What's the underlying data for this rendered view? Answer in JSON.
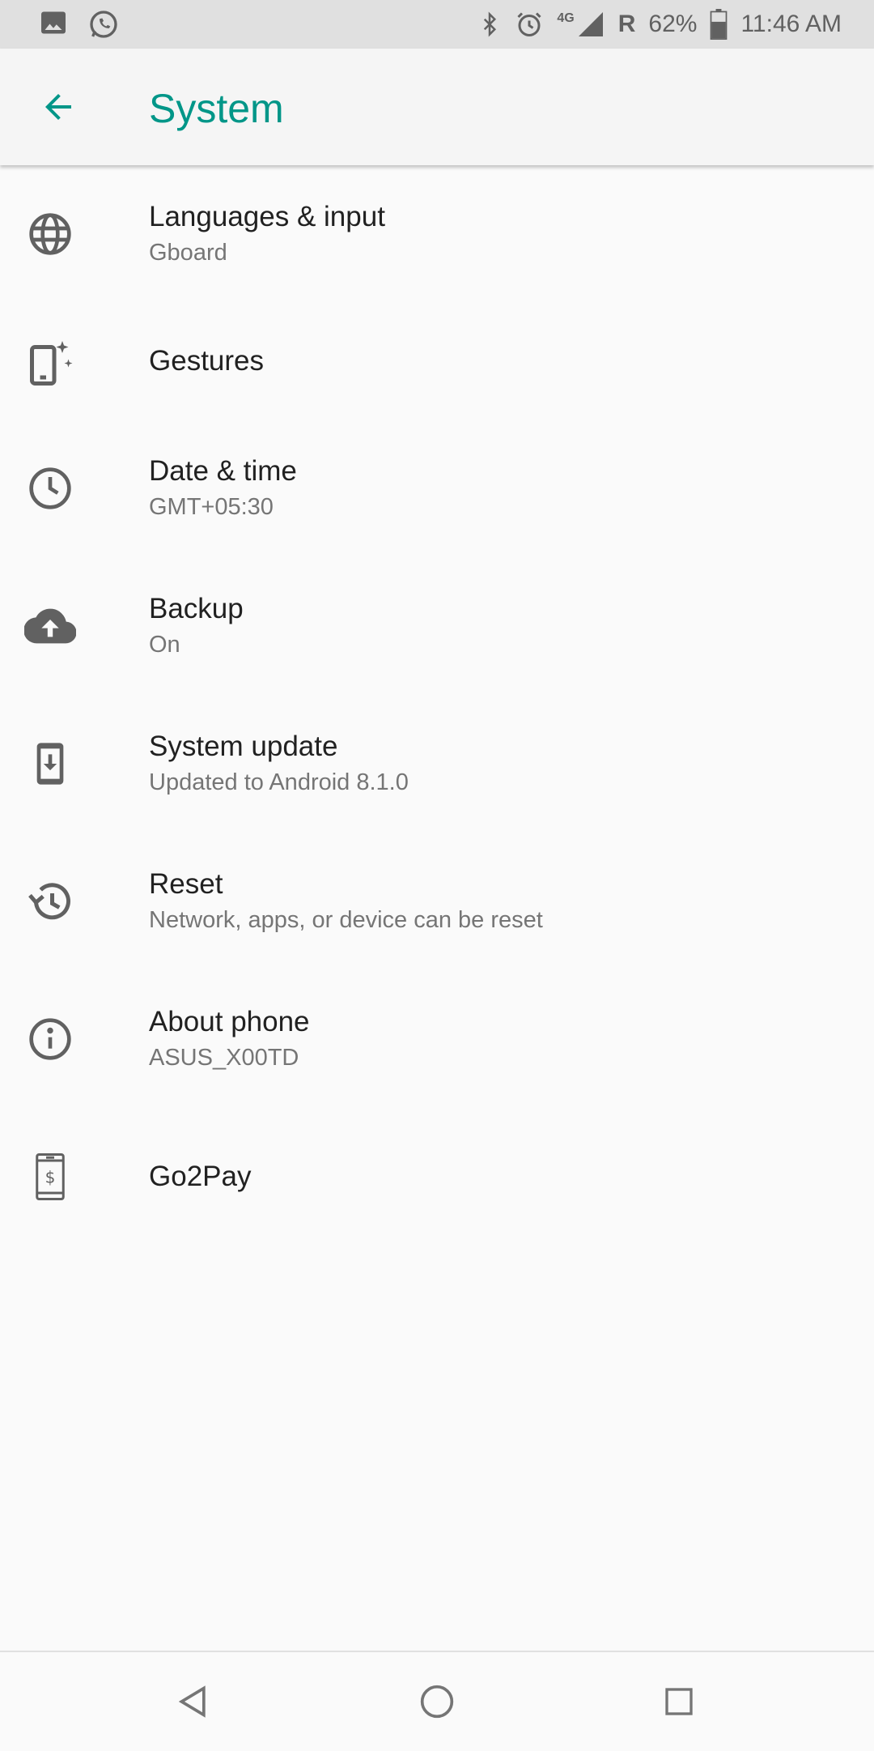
{
  "status_bar": {
    "left_icons": [
      "image-icon",
      "whatsapp-icon"
    ],
    "right_icons": [
      "bluetooth-icon",
      "alarm-icon",
      "signal-4g-icon"
    ],
    "network_type": "4G",
    "roaming": "R",
    "battery": "62%",
    "battery_level": 0.62,
    "time": "11:46 AM"
  },
  "header": {
    "title": "System",
    "back_icon": "arrow-back-icon",
    "accent_color": "#009688"
  },
  "settings": [
    {
      "title": "Languages & input",
      "subtitle": "Gboard",
      "icon": "globe-icon"
    },
    {
      "title": "Gestures",
      "subtitle": "",
      "icon": "gestures-phone-icon"
    },
    {
      "title": "Date & time",
      "subtitle": "GMT+05:30",
      "icon": "clock-icon"
    },
    {
      "title": "Backup",
      "subtitle": "On",
      "icon": "cloud-upload-icon"
    },
    {
      "title": "System update",
      "subtitle": "Updated to Android 8.1.0",
      "icon": "system-update-icon"
    },
    {
      "title": "Reset",
      "subtitle": "Network, apps, or device can be reset",
      "icon": "history-icon"
    },
    {
      "title": "About phone",
      "subtitle": "ASUS_X00TD",
      "icon": "info-icon"
    },
    {
      "title": "Go2Pay",
      "subtitle": "",
      "icon": "phone-dollar-icon"
    }
  ],
  "nav_bar": {
    "buttons": [
      "back-triangle-icon",
      "home-circle-icon",
      "recents-square-icon"
    ]
  }
}
